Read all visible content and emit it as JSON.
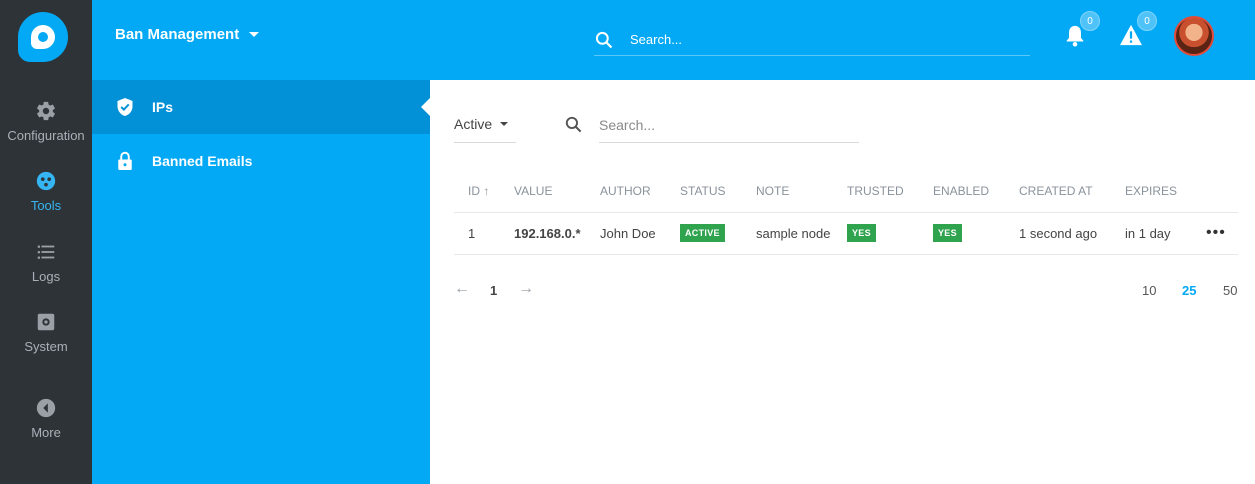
{
  "rail": {
    "items": [
      {
        "label": "Configuration",
        "icon": "gear-icon"
      },
      {
        "label": "Tools",
        "icon": "tools-icon"
      },
      {
        "label": "Logs",
        "icon": "list-icon"
      },
      {
        "label": "System",
        "icon": "system-icon"
      },
      {
        "label": "More",
        "icon": "chevron-left-circle-icon"
      }
    ],
    "active": "Tools"
  },
  "subnav": {
    "title": "Ban Management",
    "items": [
      {
        "label": "IPs",
        "icon": "shield-check-icon"
      },
      {
        "label": "Banned Emails",
        "icon": "lock-icon"
      }
    ]
  },
  "header": {
    "search_placeholder": "Search...",
    "notifications_count": "0",
    "alerts_count": "0"
  },
  "filter": {
    "status_selected": "Active",
    "search_placeholder": "Search..."
  },
  "table": {
    "columns": [
      "ID",
      "VALUE",
      "AUTHOR",
      "STATUS",
      "NOTE",
      "TRUSTED",
      "ENABLED",
      "CREATED AT",
      "EXPIRES"
    ],
    "sort_indicator": "↑",
    "rows": [
      {
        "id": "1",
        "value": "192.168.0.*",
        "author": "John Doe",
        "status": "ACTIVE",
        "note": "sample node",
        "trusted": "YES",
        "enabled": "YES",
        "created_at": "1 second ago",
        "expires": "in 1 day",
        "actions": "•••"
      }
    ]
  },
  "pagination": {
    "prev": "←",
    "current_page": "1",
    "next": "→",
    "page_sizes": [
      "10",
      "25",
      "50"
    ],
    "active_size": "25"
  },
  "colors": {
    "accent": "#03a9f4",
    "rail_bg": "#2e3338",
    "active_row": "#0290d6",
    "success": "#30a34f"
  }
}
